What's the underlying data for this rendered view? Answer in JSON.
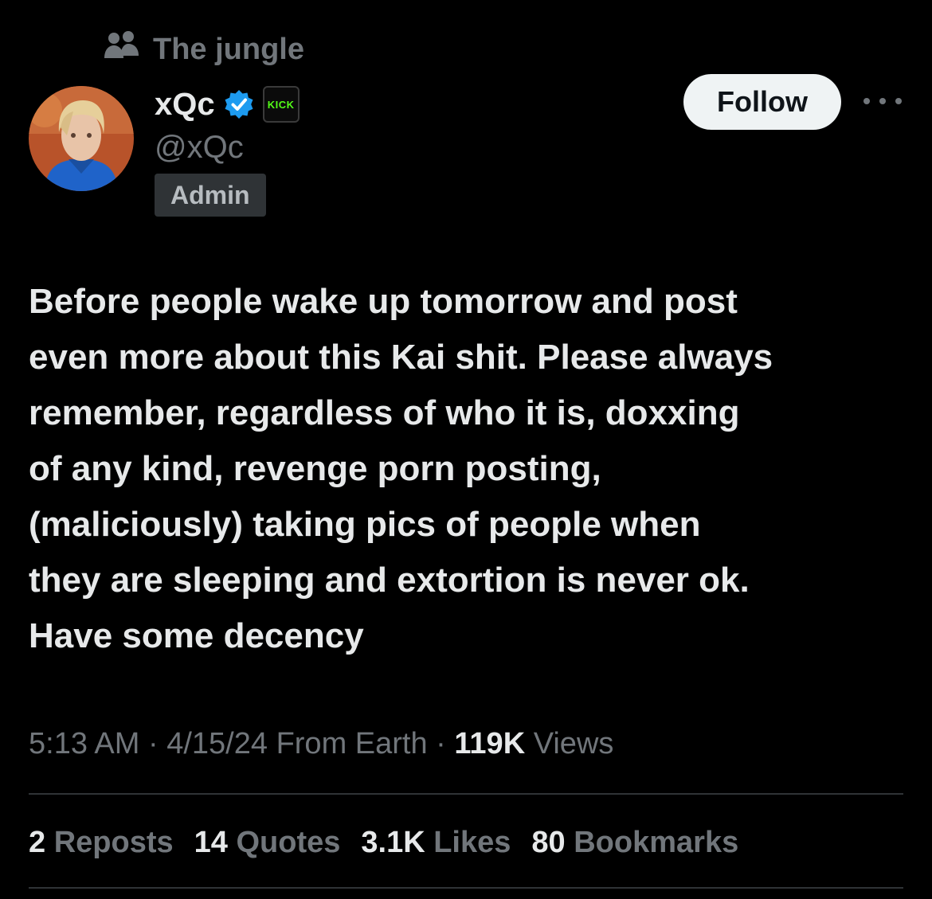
{
  "community": {
    "icon": "community-icon",
    "name": "The jungle"
  },
  "author": {
    "display_name": "xQc",
    "handle": "@xQc",
    "role": "Admin",
    "verified_icon": "verified-badge-icon",
    "affiliation_badge": "KICK",
    "affiliation_color": "#53fc18",
    "verified_color": "#1d9bf0"
  },
  "actions": {
    "follow_label": "Follow",
    "more_icon": "more-options-icon"
  },
  "tweet": {
    "text": "Before people wake up tomorrow and post\neven more about this Kai shit. Please always\nremember, regardless of who it is, doxxing\nof any kind, revenge porn posting,\n(maliciously) taking pics of people when\nthey are sleeping and extortion is never ok.\nHave some decency"
  },
  "meta": {
    "time": "5:13 AM",
    "date": "4/15/24",
    "location": "From Earth",
    "views_count": "119K",
    "views_label": "Views"
  },
  "stats": [
    {
      "count": "2",
      "label": "Reposts"
    },
    {
      "count": "14",
      "label": "Quotes"
    },
    {
      "count": "3.1K",
      "label": "Likes"
    },
    {
      "count": "80",
      "label": "Bookmarks"
    }
  ]
}
